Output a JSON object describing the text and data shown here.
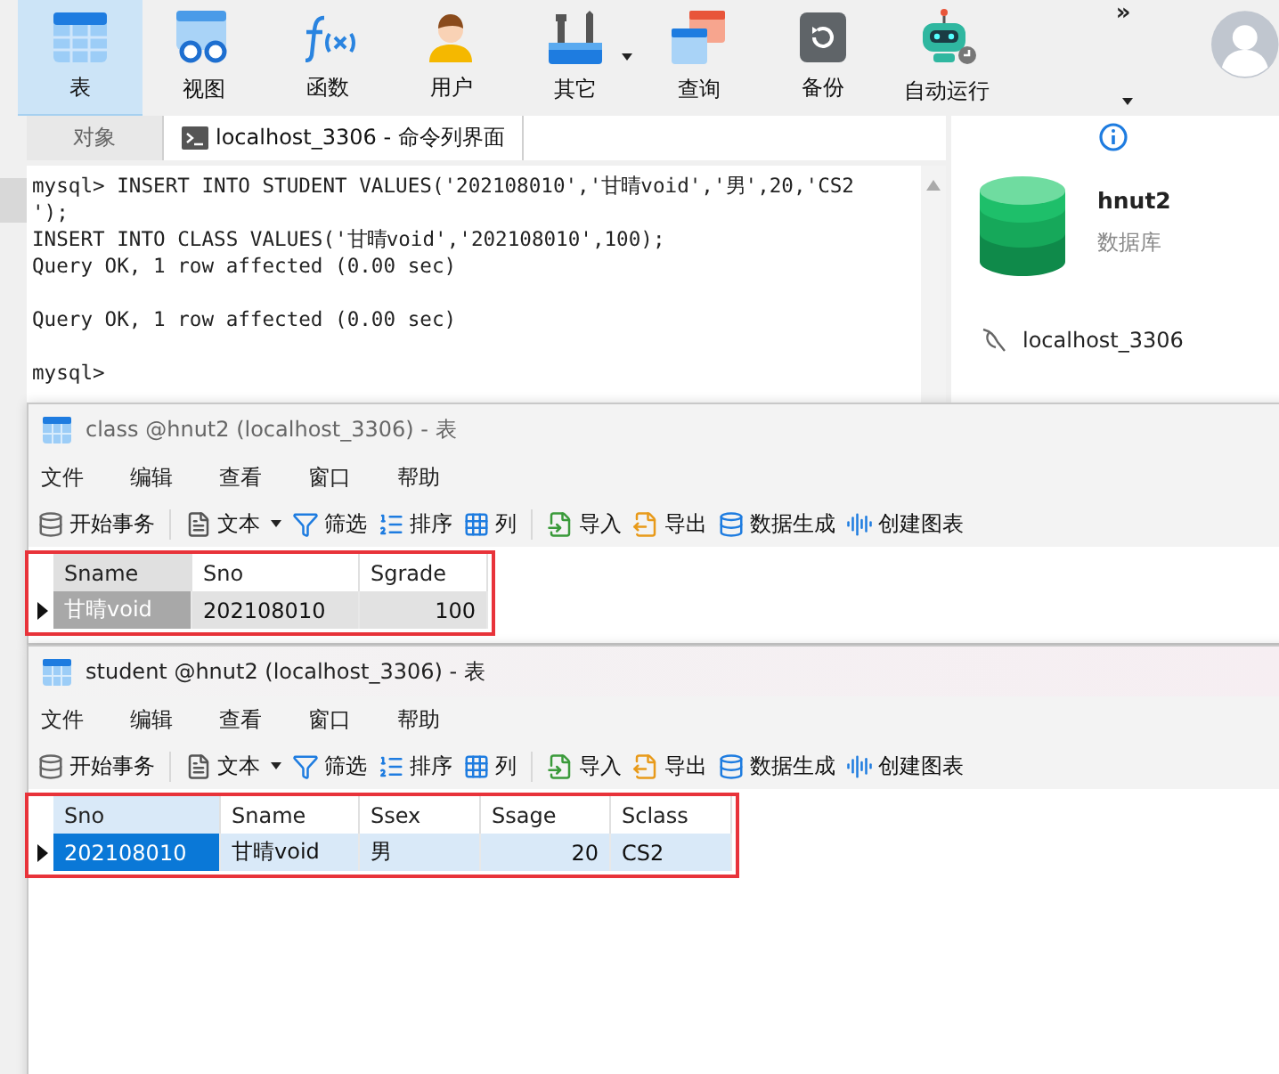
{
  "toolbar": {
    "items": [
      {
        "label": "表",
        "selected": true,
        "has_menu": false
      },
      {
        "label": "视图",
        "selected": false,
        "has_menu": false
      },
      {
        "label": "函数",
        "selected": false,
        "has_menu": false
      },
      {
        "label": "用户",
        "selected": false,
        "has_menu": false
      },
      {
        "label": "其它",
        "selected": false,
        "has_menu": true
      },
      {
        "label": "查询",
        "selected": false,
        "has_menu": false
      },
      {
        "label": "备份",
        "selected": false,
        "has_menu": false
      },
      {
        "label": "自动运行",
        "selected": false,
        "has_menu": false
      }
    ],
    "overflow": "»"
  },
  "tabs": [
    {
      "label": "对象",
      "selected": false
    },
    {
      "label": "localhost_3306 - 命令列界面",
      "selected": true
    }
  ],
  "console": {
    "lines": [
      {
        "text": "mysql> INSERT INTO STUDENT VALUES('202108010','甘晴void','男',20,'CS2",
        "gap_before": false
      },
      {
        "text": "');",
        "gap_before": false
      },
      {
        "text": "INSERT INTO CLASS VALUES('甘晴void','202108010',100);",
        "gap_before": false
      },
      {
        "text": "Query OK, 1 row affected (0.00 sec)",
        "gap_before": false
      },
      {
        "text": "Query OK, 1 row affected (0.00 sec)",
        "gap_before": true
      },
      {
        "text": "mysql>",
        "gap_before": true
      }
    ]
  },
  "info_panel": {
    "name": "hnut2",
    "type": "数据库",
    "connection": "localhost_3306"
  },
  "windows": [
    {
      "title": "class @hnut2 (localhost_3306) - 表",
      "active": false,
      "menu": [
        "文件",
        "编辑",
        "查看",
        "窗口",
        "帮助"
      ],
      "tools": [
        [
          {
            "label": "开始事务",
            "has_menu": false
          }
        ],
        [
          {
            "label": "文本",
            "has_menu": true
          },
          {
            "label": "筛选",
            "has_menu": false
          },
          {
            "label": "排序",
            "has_menu": false
          },
          {
            "label": "列",
            "has_menu": false
          }
        ],
        [
          {
            "label": "导入",
            "has_menu": false
          },
          {
            "label": "导出",
            "has_menu": false
          },
          {
            "label": "数据生成",
            "has_menu": false
          },
          {
            "label": "创建图表",
            "has_menu": false
          }
        ]
      ],
      "columns": [
        {
          "label": "Sname",
          "kind": "text"
        },
        {
          "label": "Sno",
          "kind": "text"
        },
        {
          "label": "Sgrade",
          "kind": "number"
        }
      ],
      "rows": [
        {
          "selected": true,
          "cells": [
            {
              "text": "甘晴void",
              "current": true
            },
            {
              "text": "202108010",
              "current": false
            },
            {
              "text": "100",
              "current": false
            }
          ]
        }
      ]
    },
    {
      "title": "student @hnut2 (localhost_3306) - 表",
      "active": true,
      "menu": [
        "文件",
        "编辑",
        "查看",
        "窗口",
        "帮助"
      ],
      "tools": [
        [
          {
            "label": "开始事务",
            "has_menu": false
          }
        ],
        [
          {
            "label": "文本",
            "has_menu": true
          },
          {
            "label": "筛选",
            "has_menu": false
          },
          {
            "label": "排序",
            "has_menu": false
          },
          {
            "label": "列",
            "has_menu": false
          }
        ],
        [
          {
            "label": "导入",
            "has_menu": false
          },
          {
            "label": "导出",
            "has_menu": false
          },
          {
            "label": "数据生成",
            "has_menu": false
          },
          {
            "label": "创建图表",
            "has_menu": false
          }
        ]
      ],
      "columns": [
        {
          "label": "Sno",
          "kind": "text"
        },
        {
          "label": "Sname",
          "kind": "text"
        },
        {
          "label": "Ssex",
          "kind": "text"
        },
        {
          "label": "Ssage",
          "kind": "number"
        },
        {
          "label": "Sclass",
          "kind": "text"
        }
      ],
      "rows": [
        {
          "selected": true,
          "cells": [
            {
              "text": "202108010",
              "current": true
            },
            {
              "text": "甘晴void",
              "current": false
            },
            {
              "text": "男",
              "current": false
            },
            {
              "text": "20",
              "current": false
            },
            {
              "text": "CS2",
              "current": false
            }
          ]
        }
      ]
    }
  ]
}
